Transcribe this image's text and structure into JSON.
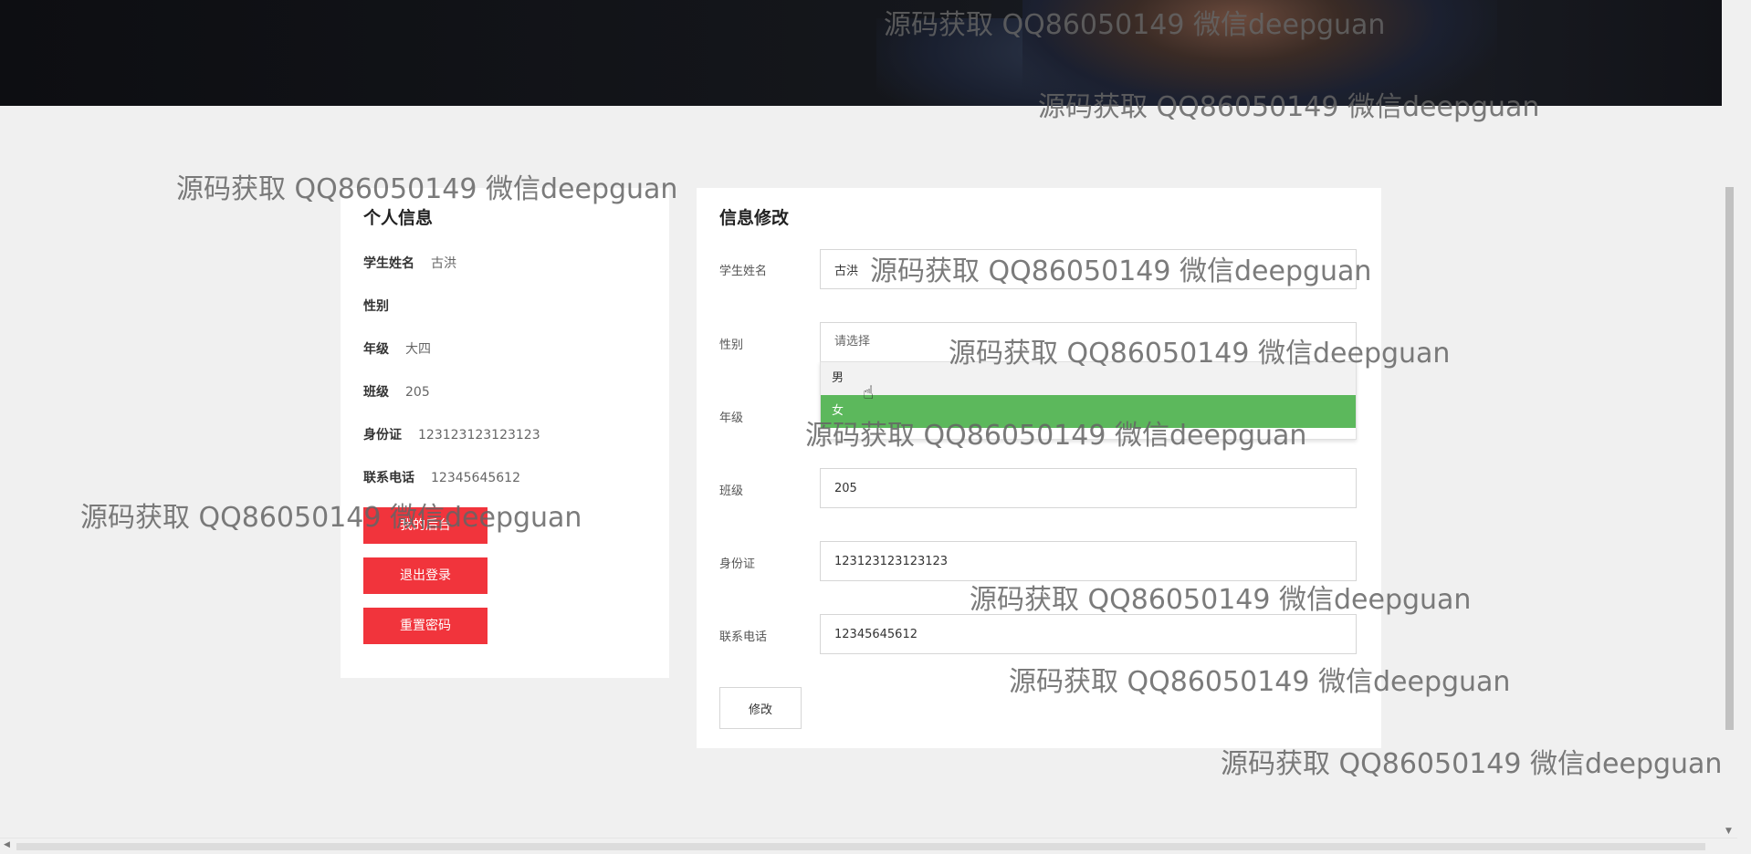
{
  "watermark_text": "源码获取 QQ86050149 微信deepguan",
  "personal_info": {
    "title": "个人信息",
    "rows": [
      {
        "label": "学生姓名",
        "value": "古洪"
      },
      {
        "label": "性别",
        "value": ""
      },
      {
        "label": "年级",
        "value": "大四"
      },
      {
        "label": "班级",
        "value": "205"
      },
      {
        "label": "身份证",
        "value": "123123123123123"
      },
      {
        "label": "联系电话",
        "value": "12345645612"
      }
    ],
    "buttons": {
      "backend": "我的后台",
      "logout": "退出登录",
      "reset_password": "重置密码"
    },
    "button_color": "#f1343c"
  },
  "edit_info": {
    "title": "信息修改",
    "fields": {
      "name": {
        "label": "学生姓名",
        "value": "古洪"
      },
      "gender": {
        "label": "性别",
        "placeholder": "请选择"
      },
      "grade": {
        "label": "年级",
        "value": ""
      },
      "class": {
        "label": "班级",
        "value": "205"
      },
      "id_card": {
        "label": "身份证",
        "value": "123123123123123"
      },
      "phone": {
        "label": "联系电话",
        "value": "12345645612"
      }
    },
    "gender_options": [
      "男",
      "女"
    ],
    "selected_option_color": "#5cb85c",
    "submit_label": "修改"
  }
}
